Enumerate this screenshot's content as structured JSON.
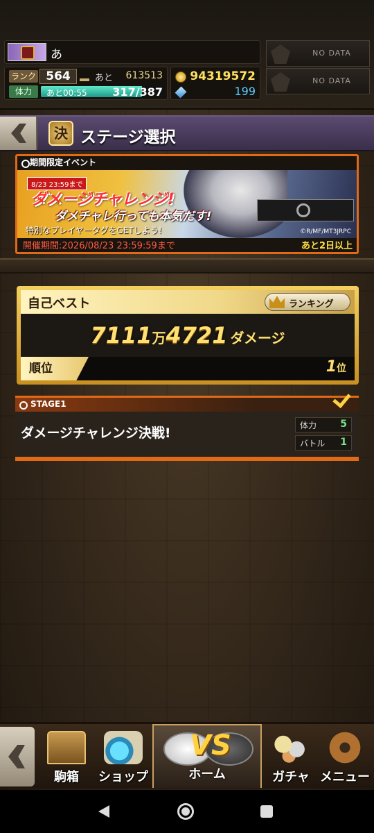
{
  "player": {
    "name": "あ",
    "rank_label": "ランク",
    "rank": "564",
    "exp_label": "あと",
    "exp_remaining": "613513",
    "stamina_label": "体力",
    "stamina_recover": "あと00:55",
    "stamina": "317/387",
    "stamina_fraction": 0.82,
    "coins": "94319572",
    "gems": "199"
  },
  "friend_slots": [
    "NO DATA",
    "NO DATA"
  ],
  "header": {
    "badge": "決",
    "title": "ステージ選択"
  },
  "event": {
    "tag": "期間限定イベント",
    "deadline_tag": "8/23 23:59まで",
    "title_main": "ダメージチャレンジ!",
    "title_sub": "ダメチャレ行っても本気だす!",
    "subtitle": "特別なプレイヤータグをGETしよう!",
    "copyright": "©R/MF/MT3JRPC",
    "period": "開催期間:2026/08/23 23:59:59まで",
    "remaining": "あと2日以上"
  },
  "best": {
    "label": "自己ベスト",
    "ranking_button": "ランキング",
    "score_man": "7111",
    "unit_man": "万",
    "score_rest": "4721",
    "score_suffix": "ダメージ",
    "rank_label": "順位",
    "rank_value": "1",
    "rank_unit": "位"
  },
  "stage": {
    "tag": "STAGE1",
    "name": "ダメージチャレンジ決戦!",
    "cost_stamina_label": "体力",
    "cost_stamina": "5",
    "cost_battle_label": "バトル",
    "cost_battle": "1"
  },
  "nav": {
    "items": [
      {
        "label": "駒箱",
        "icon": "chest-icon"
      },
      {
        "label": "ショップ",
        "icon": "shop-icon"
      },
      {
        "label": "ホーム",
        "icon": "vs-icon"
      },
      {
        "label": "ガチャ",
        "icon": "gacha-icon"
      },
      {
        "label": "メニュー",
        "icon": "gear-icon"
      }
    ],
    "home_vs": "VS"
  },
  "colors": {
    "accent_orange": "#e06a18",
    "gold": "#ffe070",
    "stamina_green": "#5ee8c8"
  }
}
